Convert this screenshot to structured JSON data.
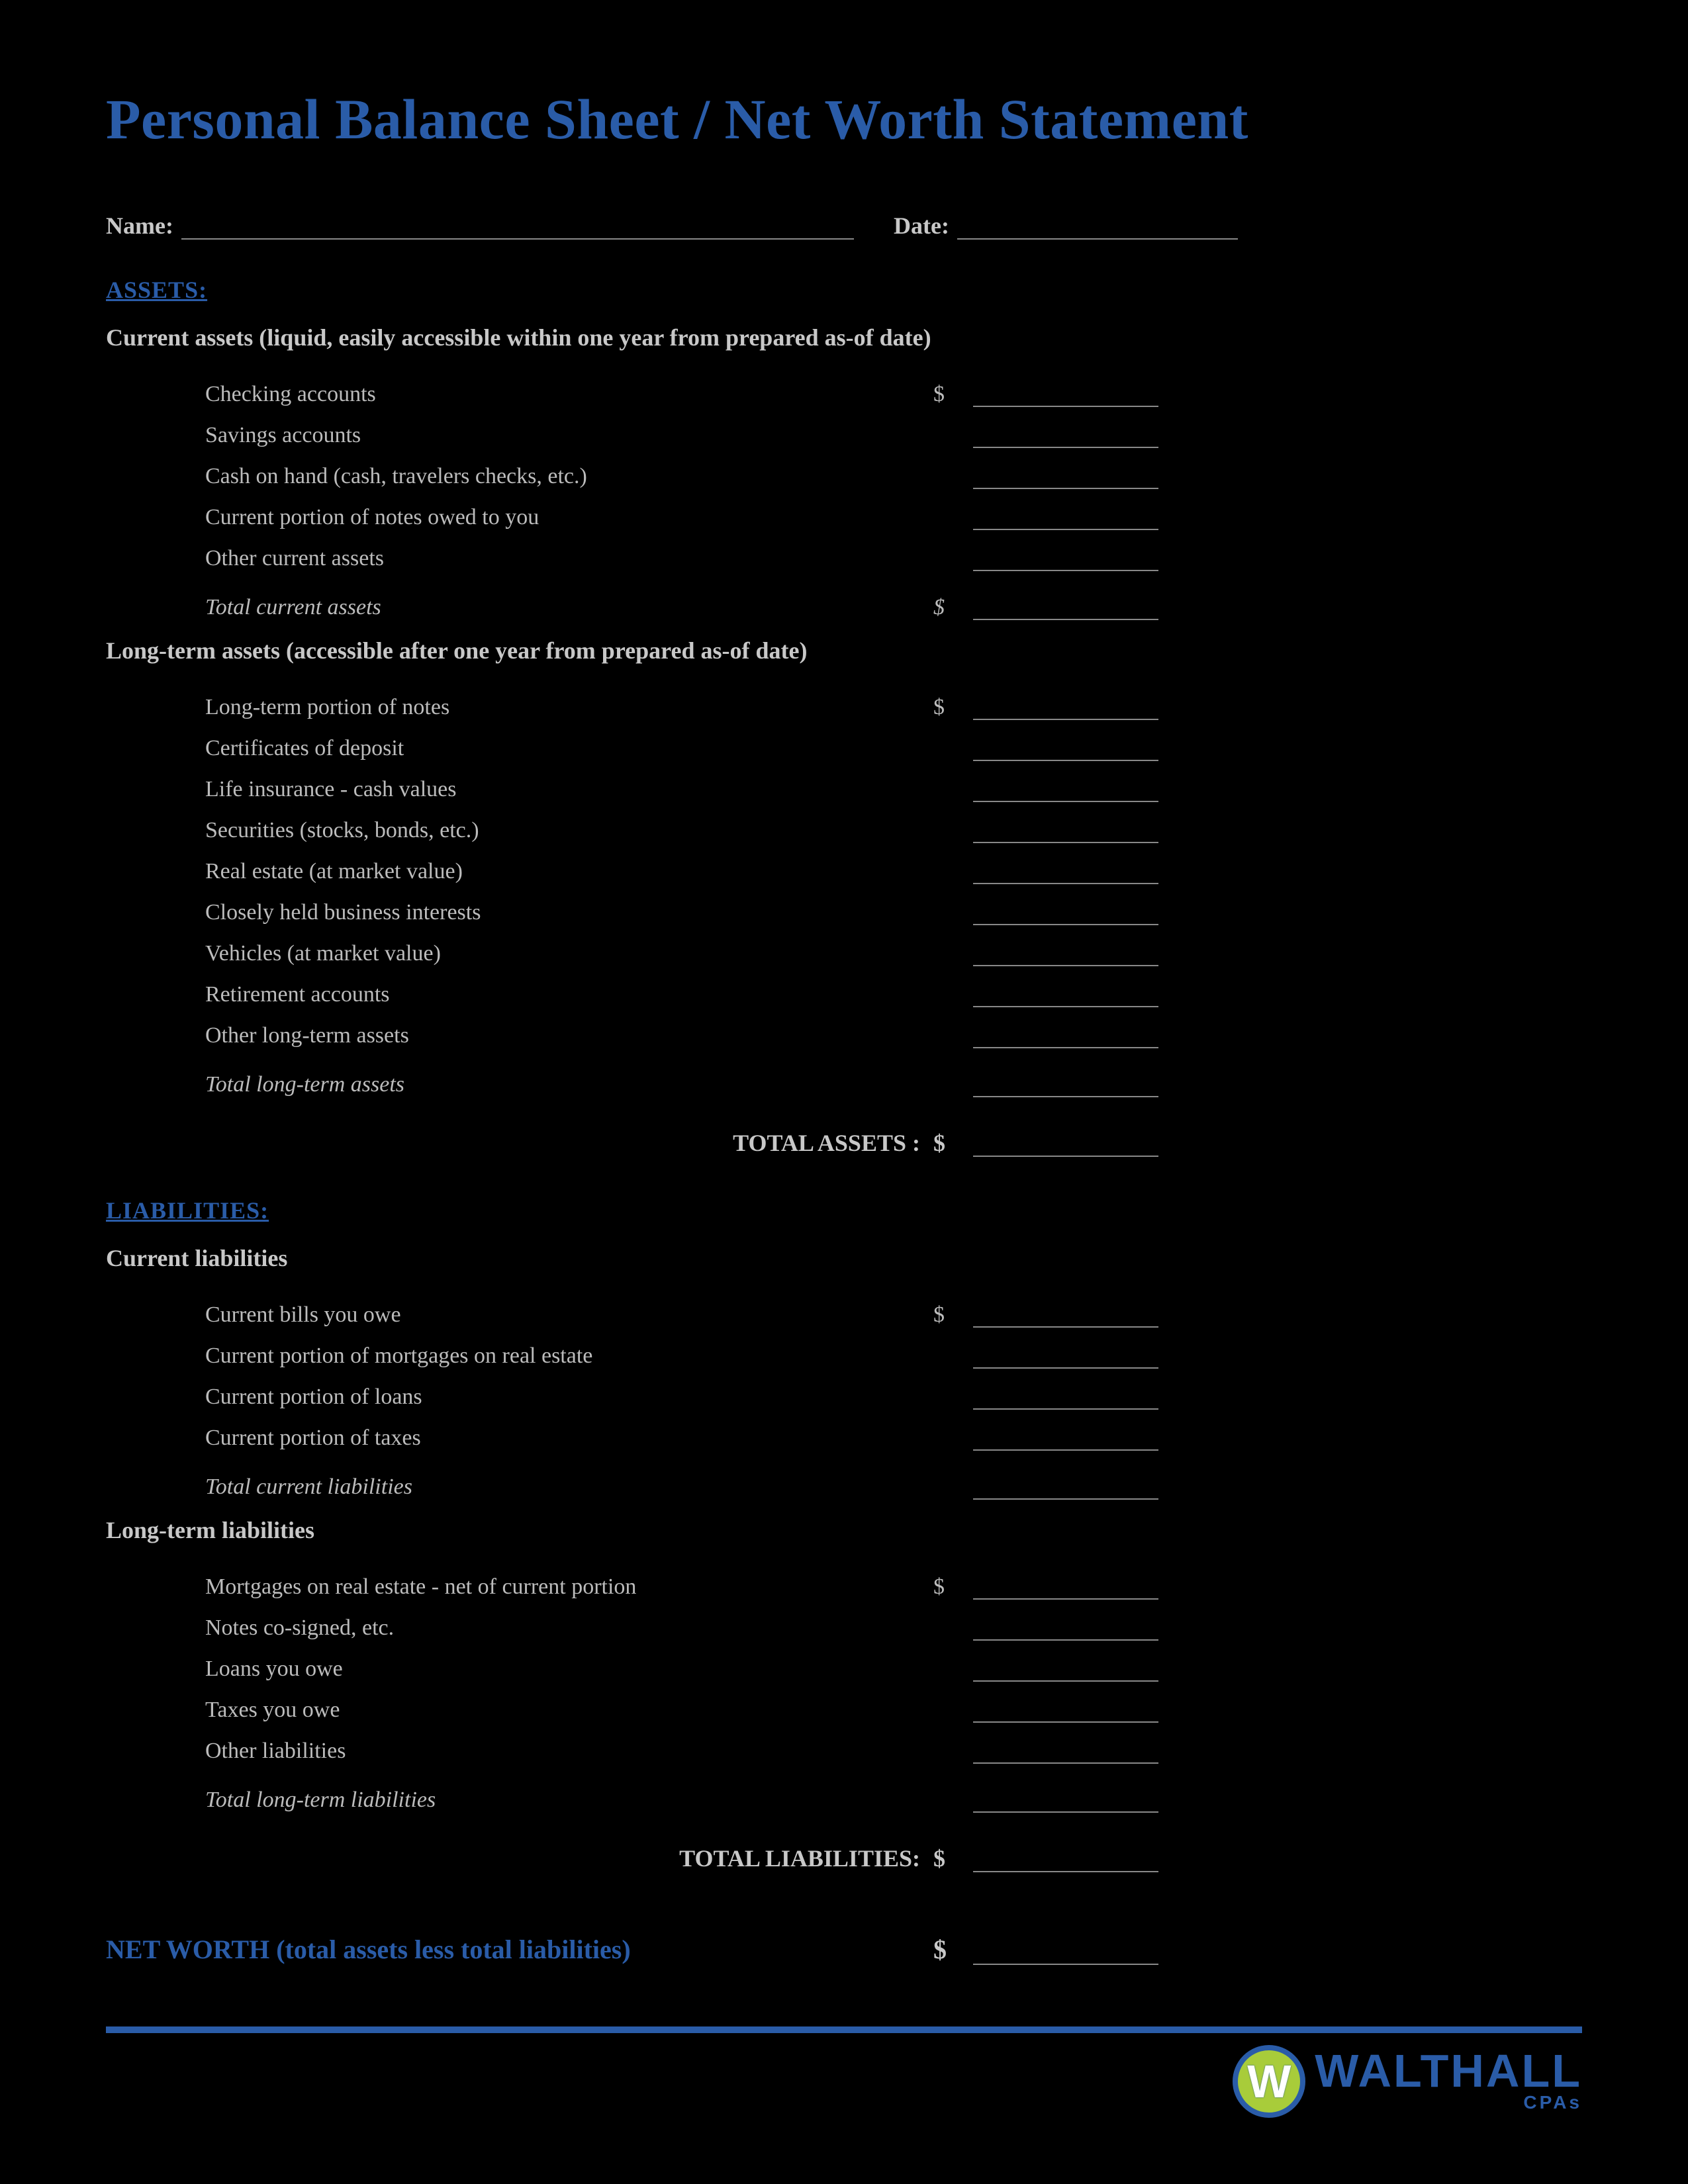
{
  "title": "Personal Balance Sheet / Net Worth Statement",
  "meta": {
    "name_label": "Name:",
    "date_label": "Date:"
  },
  "assets": {
    "heading": "ASSETS:",
    "current": {
      "subheading": "Current assets (liquid, easily accessible within one year from prepared as-of date)",
      "items": [
        "Checking accounts",
        "Savings accounts",
        "Cash on hand (cash, travelers checks, etc.)",
        "Current portion of notes owed to you",
        "Other current assets"
      ],
      "total_label": "Total current assets",
      "first_has_dollar": true,
      "total_has_dollar": true
    },
    "longterm": {
      "subheading": "Long-term assets (accessible after one year from prepared as-of date)",
      "items": [
        "Long-term portion of notes",
        "Certificates of deposit",
        "Life insurance - cash values",
        "Securities (stocks, bonds, etc.)",
        "Real estate (at market value)",
        "Closely held business interests",
        "Vehicles (at market value)",
        "Retirement accounts",
        "Other long-term assets"
      ],
      "total_label": "Total long-term assets",
      "first_has_dollar": true,
      "total_has_dollar": false
    },
    "grand_total_label": "TOTAL ASSETS :"
  },
  "liabilities": {
    "heading": "LIABILITIES:",
    "current": {
      "subheading": "Current liabilities",
      "items": [
        "Current bills you owe",
        "Current portion of mortgages on real estate",
        "Current portion of loans",
        "Current portion of taxes"
      ],
      "total_label": "Total current liabilities",
      "first_has_dollar": true,
      "total_has_dollar": false
    },
    "longterm": {
      "subheading": "Long-term liabilities",
      "items": [
        "Mortgages on real estate - net of current portion",
        "Notes co-signed, etc.",
        "Loans you owe",
        "Taxes you owe",
        "Other liabilities"
      ],
      "total_label": "Total long-term liabilities",
      "first_has_dollar": true,
      "total_has_dollar": false
    },
    "grand_total_label": "TOTAL LIABILITIES:"
  },
  "networth_label": "NET WORTH (total assets less total liabilities)",
  "footer": {
    "brand": "WALTHALL",
    "sub": "CPAs"
  },
  "dollar_sign": "$"
}
